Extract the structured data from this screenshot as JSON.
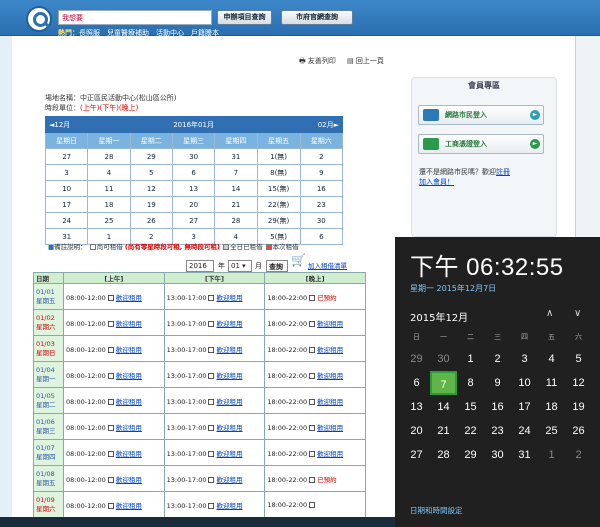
{
  "header": {
    "search_value": "我想要",
    "btn_search": "申辦項目查詢",
    "btn_org": "市府官網查詢",
    "hot_label": "熱門：",
    "hot_items": "長照服　兒童醫療補助　活動中心　戶籍謄本"
  },
  "toplinks": {
    "print": "友善列印",
    "back": "回上一頁"
  },
  "venue": {
    "name_line": "場地名稱：中正區民活動中心(松山區公所)",
    "period_label": "時段單位：",
    "period_value": "(上午)(下午)(晚上)"
  },
  "calendar": {
    "prev": "12月",
    "title": "2016年01月",
    "next": "02月",
    "weekdays": [
      "星期日",
      "星期一",
      "星期二",
      "星期三",
      "星期四",
      "星期五",
      "星期六"
    ],
    "rows": [
      [
        "27",
        "28",
        "29",
        "30",
        "31",
        "1(無)",
        "2"
      ],
      [
        "3",
        "4",
        "5",
        "6",
        "7",
        "8(無)",
        "9"
      ],
      [
        "10",
        "11",
        "12",
        "13",
        "14",
        "15(無)",
        "16"
      ],
      [
        "17",
        "18",
        "19",
        "20",
        "21",
        "22(無)",
        "23"
      ],
      [
        "24",
        "25",
        "26",
        "27",
        "28",
        "29(無)",
        "30"
      ],
      [
        "31",
        "1",
        "2",
        "3",
        "4",
        "5(無)",
        "6"
      ]
    ]
  },
  "legend": {
    "label": "備註說明：",
    "available": "尚可租借",
    "red_note": "(尚有零星時段可租, 無時段可租)",
    "booked_all": "全日已租借",
    "mine": "本次租借"
  },
  "controls": {
    "year": "2016",
    "year_unit": "年",
    "month": "01",
    "month_unit": "月",
    "query": "查詢",
    "cart": "加入租借清單"
  },
  "booking": {
    "headers": [
      "日期",
      "[上午]",
      "[下午]",
      "[晚上]"
    ],
    "rows": [
      {
        "date": "01/01",
        "dow": "星期五",
        "am": "08:00-12:00",
        "pm": "13:00-17:00",
        "ev": "18:00-22:00",
        "ev_status": "已預約",
        "ev_red": true,
        "red": false
      },
      {
        "date": "01/02",
        "dow": "星期六",
        "am": "08:00-12:00",
        "pm": "13:00-17:00",
        "ev": "18:00-22:00",
        "ev_status": "歡迎租用",
        "ev_red": false,
        "red": true
      },
      {
        "date": "01/03",
        "dow": "星期日",
        "am": "08:00-12:00",
        "pm": "13:00-17:00",
        "ev": "18:00-22:00",
        "ev_status": "歡迎租用",
        "ev_red": false,
        "red": true
      },
      {
        "date": "01/04",
        "dow": "星期一",
        "am": "08:00-12:00",
        "pm": "13:00-17:00",
        "ev": "18:00-22:00",
        "ev_status": "歡迎租用",
        "ev_red": false,
        "red": false
      },
      {
        "date": "01/05",
        "dow": "星期二",
        "am": "08:00-12:00",
        "pm": "13:00-17:00",
        "ev": "18:00-22:00",
        "ev_status": "歡迎租用",
        "ev_red": false,
        "red": false
      },
      {
        "date": "01/06",
        "dow": "星期三",
        "am": "08:00-12:00",
        "pm": "13:00-17:00",
        "ev": "18:00-22:00",
        "ev_status": "歡迎租用",
        "ev_red": false,
        "red": false
      },
      {
        "date": "01/07",
        "dow": "星期四",
        "am": "08:00-12:00",
        "pm": "13:00-17:00",
        "ev": "18:00-22:00",
        "ev_status": "歡迎租用",
        "ev_red": false,
        "red": false
      },
      {
        "date": "01/08",
        "dow": "星期五",
        "am": "08:00-12:00",
        "pm": "13:00-17:00",
        "ev": "18:00-22:00",
        "ev_status": "已預約",
        "ev_red": true,
        "red": false
      },
      {
        "date": "01/09",
        "dow": "星期六",
        "am": "08:00-12:00",
        "pm": "13:00-17:00",
        "ev": "18:00-22:00",
        "ev_status": "",
        "ev_red": false,
        "red": true
      }
    ],
    "welcome": "歡迎租用"
  },
  "sidebar": {
    "title": "會員專區",
    "citizen_login": "網路市民登入",
    "business_login": "工商憑證登入",
    "register_text": "還不是網路市民嗎？歡迎",
    "register_link": "註冊",
    "join_link": "加入會員！"
  },
  "flyout": {
    "time": "下午 06:32:55",
    "date": "星期一 2015年12月7日",
    "month": "2015年12月",
    "weekdays": [
      "日",
      "一",
      "二",
      "三",
      "四",
      "五",
      "六"
    ],
    "days": [
      [
        "29",
        "30",
        "1",
        "2",
        "3",
        "4",
        "5"
      ],
      [
        "6",
        "7",
        "8",
        "9",
        "10",
        "11",
        "12"
      ],
      [
        "13",
        "14",
        "15",
        "16",
        "17",
        "18",
        "19"
      ],
      [
        "20",
        "21",
        "22",
        "23",
        "24",
        "25",
        "26"
      ],
      [
        "27",
        "28",
        "29",
        "30",
        "31",
        "1",
        "2"
      ]
    ],
    "settings_link": "日期和時間設定"
  }
}
